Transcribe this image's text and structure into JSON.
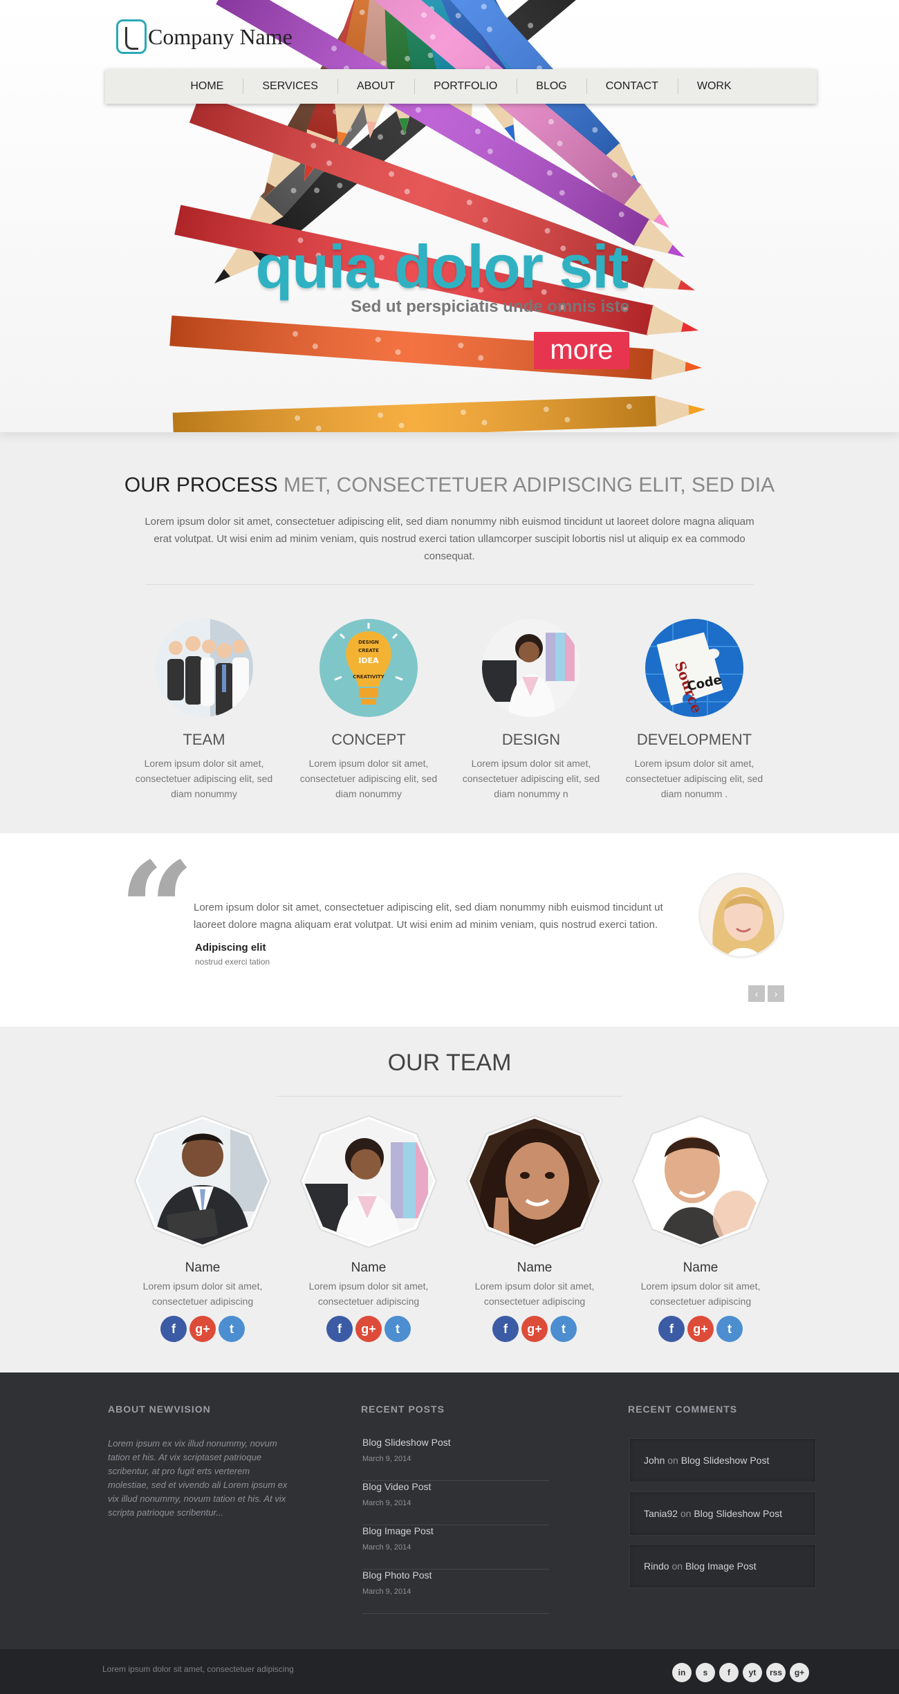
{
  "header": {
    "logo_text": "Company Name",
    "nav": [
      "HOME",
      "SERVICES",
      "ABOUT",
      "PORTFOLIO",
      "BLOG",
      "CONTACT",
      "WORK"
    ]
  },
  "hero": {
    "title": "quia dolor sit",
    "subtitle": "Sed ut perspiciatis unde omnis iste",
    "button": "more"
  },
  "process": {
    "heading_strong": "OUR PROCESS",
    "heading_light": "MET, CONSECTETUER ADIPISCING ELIT, SED DIA",
    "text": "Lorem ipsum dolor sit amet, consectetuer adipiscing elit, sed diam nonummy nibh euismod tincidunt ut laoreet dolore magna aliquam erat volutpat. Ut wisi enim ad minim veniam, quis nostrud exerci tation ullamcorper suscipit lobortis nisl ut aliquip ex ea commodo consequat.",
    "features": [
      {
        "title": "TEAM",
        "text": "Lorem ipsum dolor sit amet, consectetuer adipiscing elit, sed diam nonummy"
      },
      {
        "title": "CONCEPT",
        "text": "Lorem ipsum dolor sit amet, consectetuer adipiscing elit, sed diam nonummy"
      },
      {
        "title": "DESIGN",
        "text": "Lorem ipsum dolor sit amet, consectetuer adipiscing elit, sed diam nonummy n"
      },
      {
        "title": "DEVELOPMENT",
        "text": "Lorem ipsum dolor sit amet, consectetuer adipiscing elit, sed diam nonumm ."
      }
    ],
    "concept_words": [
      "DESIGN",
      "CREATE",
      "IDEA",
      "CREATIVITY"
    ],
    "source_code_words": [
      "Source",
      "Code"
    ]
  },
  "testimonial": {
    "quote": "Lorem ipsum dolor sit amet, consectetuer adipiscing elit, sed diam nonummy nibh euismod tincidunt ut laoreet dolore magna aliquam erat volutpat. Ut wisi enim ad minim veniam, quis nostrud exerci tation.",
    "author": "Adipiscing elit",
    "role": "nostrud exerci tation",
    "prev": "‹",
    "next": "›"
  },
  "team": {
    "heading": "OUR TEAM",
    "members": [
      {
        "name": "Name",
        "text": "Lorem ipsum dolor sit amet, consectetuer adipiscing"
      },
      {
        "name": "Name",
        "text": "Lorem ipsum dolor sit amet, consectetuer adipiscing"
      },
      {
        "name": "Name",
        "text": "Lorem ipsum dolor sit amet, consectetuer adipiscing"
      },
      {
        "name": "Name",
        "text": "Lorem ipsum dolor sit amet, consectetuer adipiscing"
      }
    ],
    "social_labels": {
      "facebook": "f",
      "googleplus": "g+",
      "twitter": "t"
    }
  },
  "footer": {
    "about_title": "ABOUT NEWVISION",
    "about_text": "Lorem ipsum ex vix illud nonummy, novum tation et his. At vix scriptaset patrioque scribentur, at pro fugit erts verterem molestiae, sed et vivendo ali Lorem ipsum ex vix illud nonummy, novum tation et his. At vix scripta patrioque scribentur...",
    "posts_title": "RECENT POSTS",
    "posts": [
      {
        "title": "Blog Slideshow Post",
        "date": "March 9, 2014"
      },
      {
        "title": "Blog Video Post",
        "date": "March 9, 2014"
      },
      {
        "title": "Blog Image Post",
        "date": "March 9, 2014"
      },
      {
        "title": "Blog Photo Post",
        "date": "March 9, 2014"
      }
    ],
    "comments_title": "RECENT COMMENTS",
    "comments": [
      {
        "user": "John",
        "on": "on",
        "post": "Blog Slideshow Post"
      },
      {
        "user": "Tania92",
        "on": "on",
        "post": "Blog Slideshow Post"
      },
      {
        "user": "Rindo",
        "on": "on",
        "post": "Blog Image Post"
      }
    ],
    "copyright": "Lorem ipsum dolor sit amet, consectetuer adipiscing",
    "social_icons": [
      "in",
      "s",
      "f",
      "yt",
      "rss",
      "g+"
    ]
  },
  "colors": {
    "accent": "#2fb1c2",
    "button": "#e8354f",
    "footer": "#2f3135"
  }
}
